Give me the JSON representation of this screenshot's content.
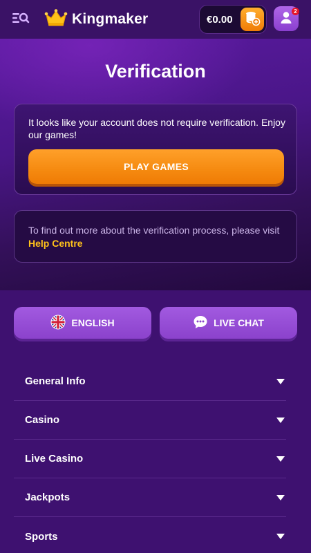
{
  "header": {
    "brand_name": "Kingmaker",
    "balance": "€0.00",
    "notification_count": "2"
  },
  "main": {
    "title": "Verification",
    "verify_message": "It looks like your account does not require verification. Enjoy our games!",
    "play_button": "PLAY GAMES",
    "help_prefix": "To find out more about the verification process, please visit ",
    "help_link": "Help Centre"
  },
  "footer": {
    "language_button": "ENGLISH",
    "chat_button": "LIVE CHAT",
    "accordion": [
      {
        "label": "General Info"
      },
      {
        "label": "Casino"
      },
      {
        "label": "Live Casino"
      },
      {
        "label": "Jackpots"
      },
      {
        "label": "Sports"
      }
    ]
  },
  "colors": {
    "accent_orange": "#f58a10",
    "link_yellow": "#ffc21a",
    "purple_button": "#9a50d8"
  },
  "icons": {
    "menu": "search-menu-icon",
    "logo": "crown-icon",
    "deposit": "coins-plus-icon",
    "profile": "user-icon",
    "language": "uk-flag-icon",
    "chat": "chat-bubble-icon",
    "accordion": "triangle-down-icon"
  }
}
